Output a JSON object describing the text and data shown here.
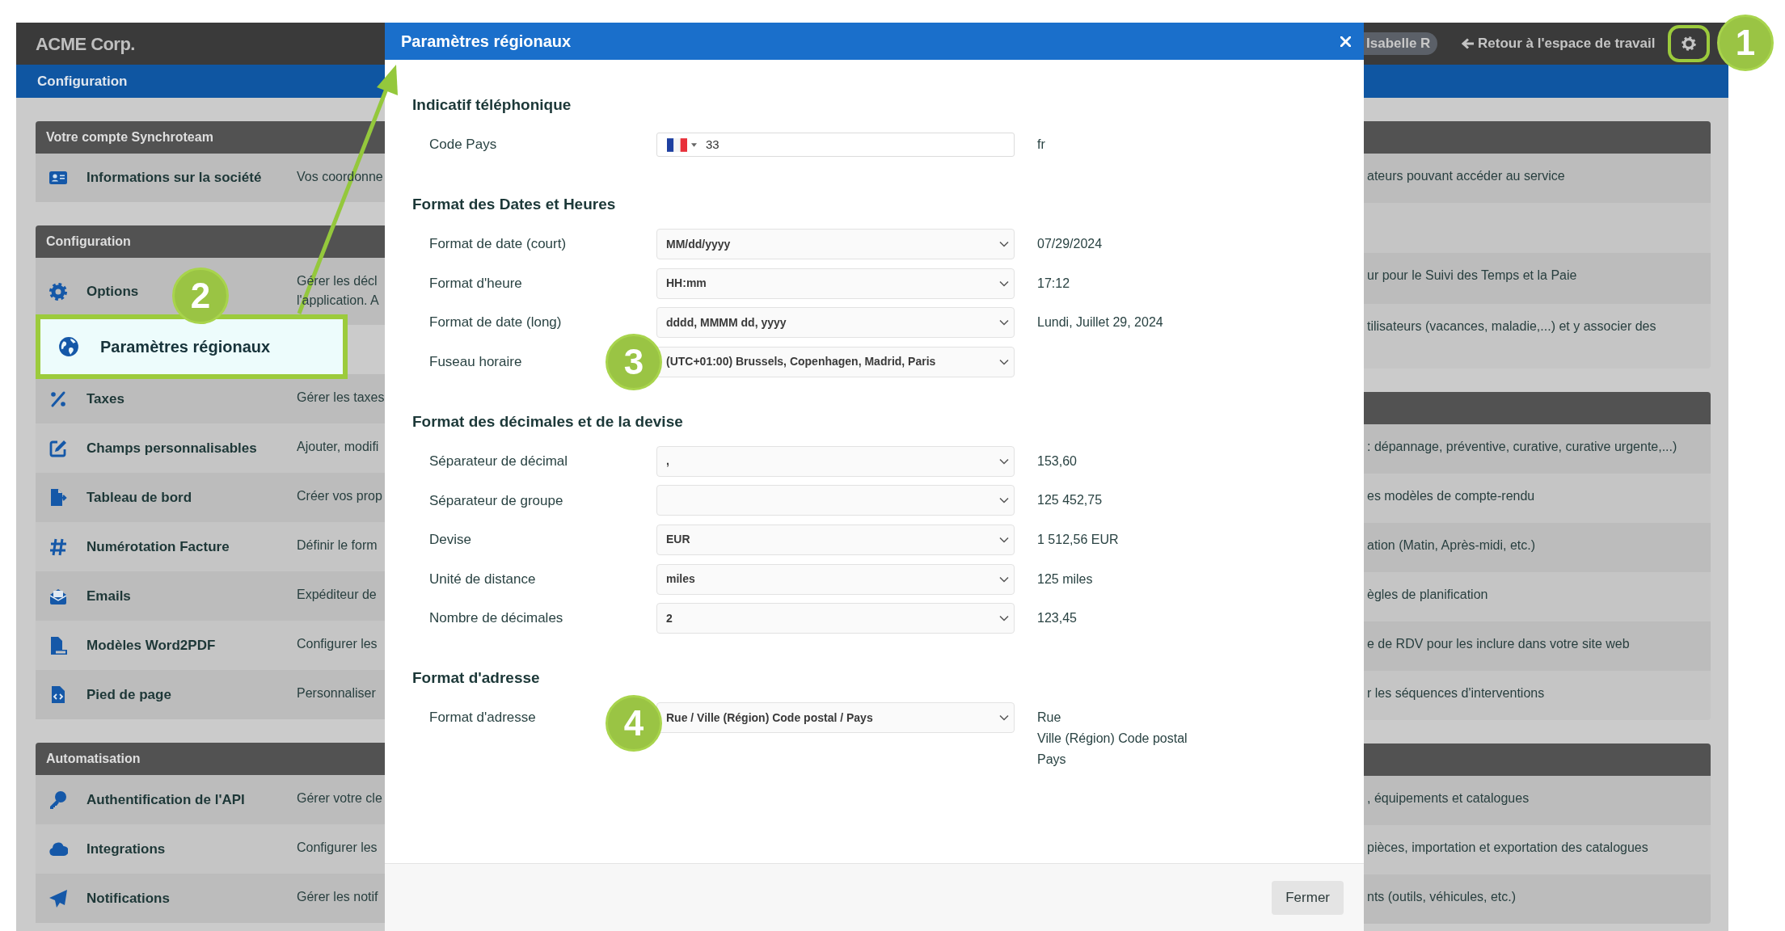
{
  "app": {
    "brand": "ACME Corp.",
    "page_title": "Configuration",
    "user": "Isabelle R",
    "back_link": "Retour à l'espace de travail"
  },
  "left_sections": [
    {
      "title": "Votre compte Synchroteam",
      "items": [
        {
          "label": "Informations sur la société",
          "description": [
            "Vos coordonne"
          ],
          "highlighted": false
        }
      ]
    },
    {
      "title": "Configuration",
      "items": [
        {
          "label": "Options",
          "description": [
            "Gérer les décl",
            "l'application. A"
          ],
          "highlighted": false
        },
        {
          "label": "Paramètres régionaux",
          "highlighted": true
        },
        {
          "label": "Taxes",
          "description": [
            "Gérer les taxes"
          ],
          "highlighted": false
        },
        {
          "label": "Champs personnalisables",
          "description": [
            "Ajouter, modifi"
          ],
          "highlighted": false
        },
        {
          "label": "Tableau de bord",
          "description": [
            "Créer vos prop"
          ],
          "highlighted": false
        },
        {
          "label": "Numérotation Facture",
          "description": [
            "Définir le form"
          ],
          "highlighted": false
        },
        {
          "label": "Emails",
          "description": [
            "Expéditeur de"
          ],
          "highlighted": false
        },
        {
          "label": "Modèles Word2PDF",
          "description": [
            "Configurer les"
          ],
          "highlighted": false
        },
        {
          "label": "Pied de page",
          "description": [
            "Personnaliser"
          ],
          "highlighted": false
        }
      ]
    },
    {
      "title": "Automatisation",
      "items": [
        {
          "label": "Authentification de l'API",
          "description": [
            "Gérer votre cle"
          ],
          "highlighted": false
        },
        {
          "label": "Integrations",
          "description": [
            "Configurer les"
          ],
          "highlighted": false
        },
        {
          "label": "Notifications",
          "description": [
            "Gérer les notif"
          ],
          "highlighted": false
        }
      ]
    }
  ],
  "right_sections": [
    {
      "rows": [
        {
          "description": "ateurs pouvant accéder au service"
        },
        {},
        {
          "description": "ur pour le Suivi des Temps et la Paie"
        },
        {
          "description": "tilisateurs (vacances, maladie,...) et y associer des"
        }
      ]
    },
    {
      "rows": [
        {
          "description": ": dépannage, préventive, curative, curative urgente,...)"
        },
        {
          "description": "es modèles de compte-rendu"
        },
        {
          "description": "ation (Matin, Après-midi, etc.)"
        },
        {
          "description": "ègles de planification"
        },
        {
          "description": "e de RDV pour les inclure dans votre site web"
        },
        {
          "description": "r les séquences d'interventions"
        }
      ]
    },
    {
      "rows": [
        {
          "description": ", équipements et catalogues"
        },
        {
          "description": "pièces, importation et exportation des catalogues"
        },
        {
          "description": "nts (outils, véhicules, etc.)"
        }
      ]
    }
  ],
  "dialog": {
    "title": "Paramètres régionaux",
    "sections": [
      {
        "heading": "Indicatif téléphonique",
        "fields": [
          {
            "kind": "phone",
            "label": "Code Pays",
            "value": "33",
            "preview": [
              "fr"
            ]
          }
        ]
      },
      {
        "heading": "Format des Dates et Heures",
        "fields": [
          {
            "kind": "select",
            "label": "Format de date (court)",
            "value": "MM/dd/yyyy",
            "preview": [
              "07/29/2024"
            ]
          },
          {
            "kind": "select",
            "label": "Format d'heure",
            "value": "HH:mm",
            "preview": [
              "17:12"
            ]
          },
          {
            "kind": "select",
            "label": "Format de date (long)",
            "value": "dddd, MMMM dd, yyyy",
            "preview": [
              "Lundi, Juillet 29, 2024"
            ]
          },
          {
            "kind": "select",
            "label": "Fuseau horaire",
            "value": "(UTC+01:00) Brussels, Copenhagen, Madrid, Paris"
          }
        ]
      },
      {
        "heading": "Format des décimales et de la devise",
        "fields": [
          {
            "kind": "select",
            "label": "Séparateur de décimal",
            "value": ",",
            "preview": [
              "153,60"
            ]
          },
          {
            "kind": "select",
            "label": "Séparateur de groupe",
            "preview": [
              "125 452,75"
            ]
          },
          {
            "kind": "select",
            "label": "Devise",
            "value": "EUR",
            "preview": [
              "1 512,56 EUR"
            ]
          },
          {
            "kind": "select",
            "label": "Unité de distance",
            "value": "miles",
            "preview": [
              "125 miles"
            ]
          },
          {
            "kind": "select",
            "label": "Nombre de décimales",
            "value": "2",
            "preview": [
              "123,45"
            ]
          }
        ]
      },
      {
        "heading": "Format d'adresse",
        "fields": [
          {
            "kind": "select",
            "label": "Format d'adresse",
            "value": "Rue / Ville (Région) Code postal / Pays",
            "preview": [
              "Rue",
              "Ville (Région) Code postal",
              "Pays"
            ]
          }
        ]
      }
    ],
    "close_button": "Fermer"
  },
  "callouts": [
    {
      "label": "1"
    },
    {
      "label": "2"
    },
    {
      "label": "3"
    },
    {
      "label": "4"
    }
  ]
}
